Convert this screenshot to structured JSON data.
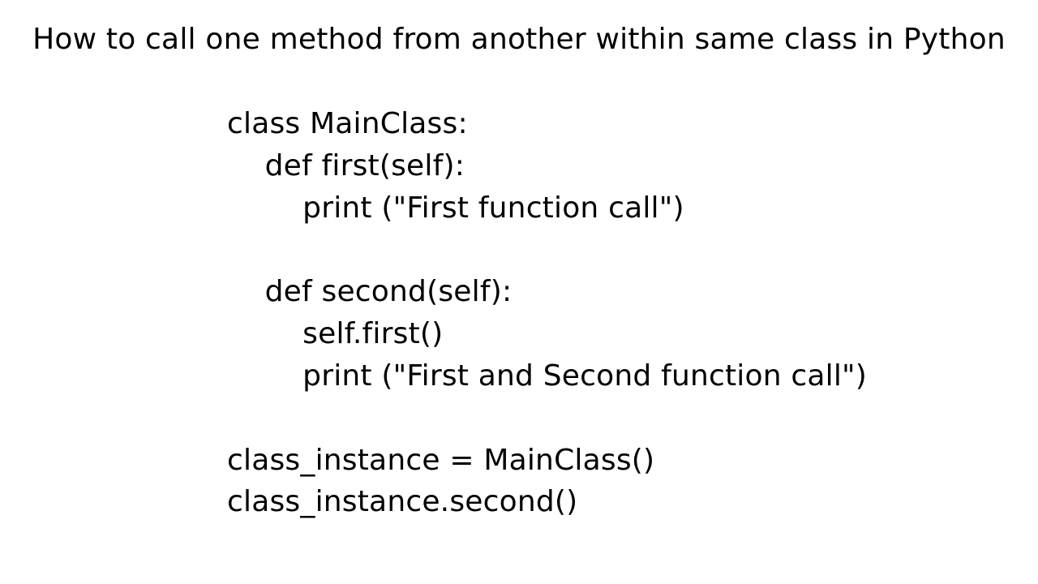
{
  "title": "How to call one method from another within same class in Python",
  "code": "class MainClass:\n    def first(self):\n        print (\"First function call\")\n\n    def second(self):\n        self.first()\n        print (\"First and Second function call\")\n\nclass_instance = MainClass()\nclass_instance.second()"
}
